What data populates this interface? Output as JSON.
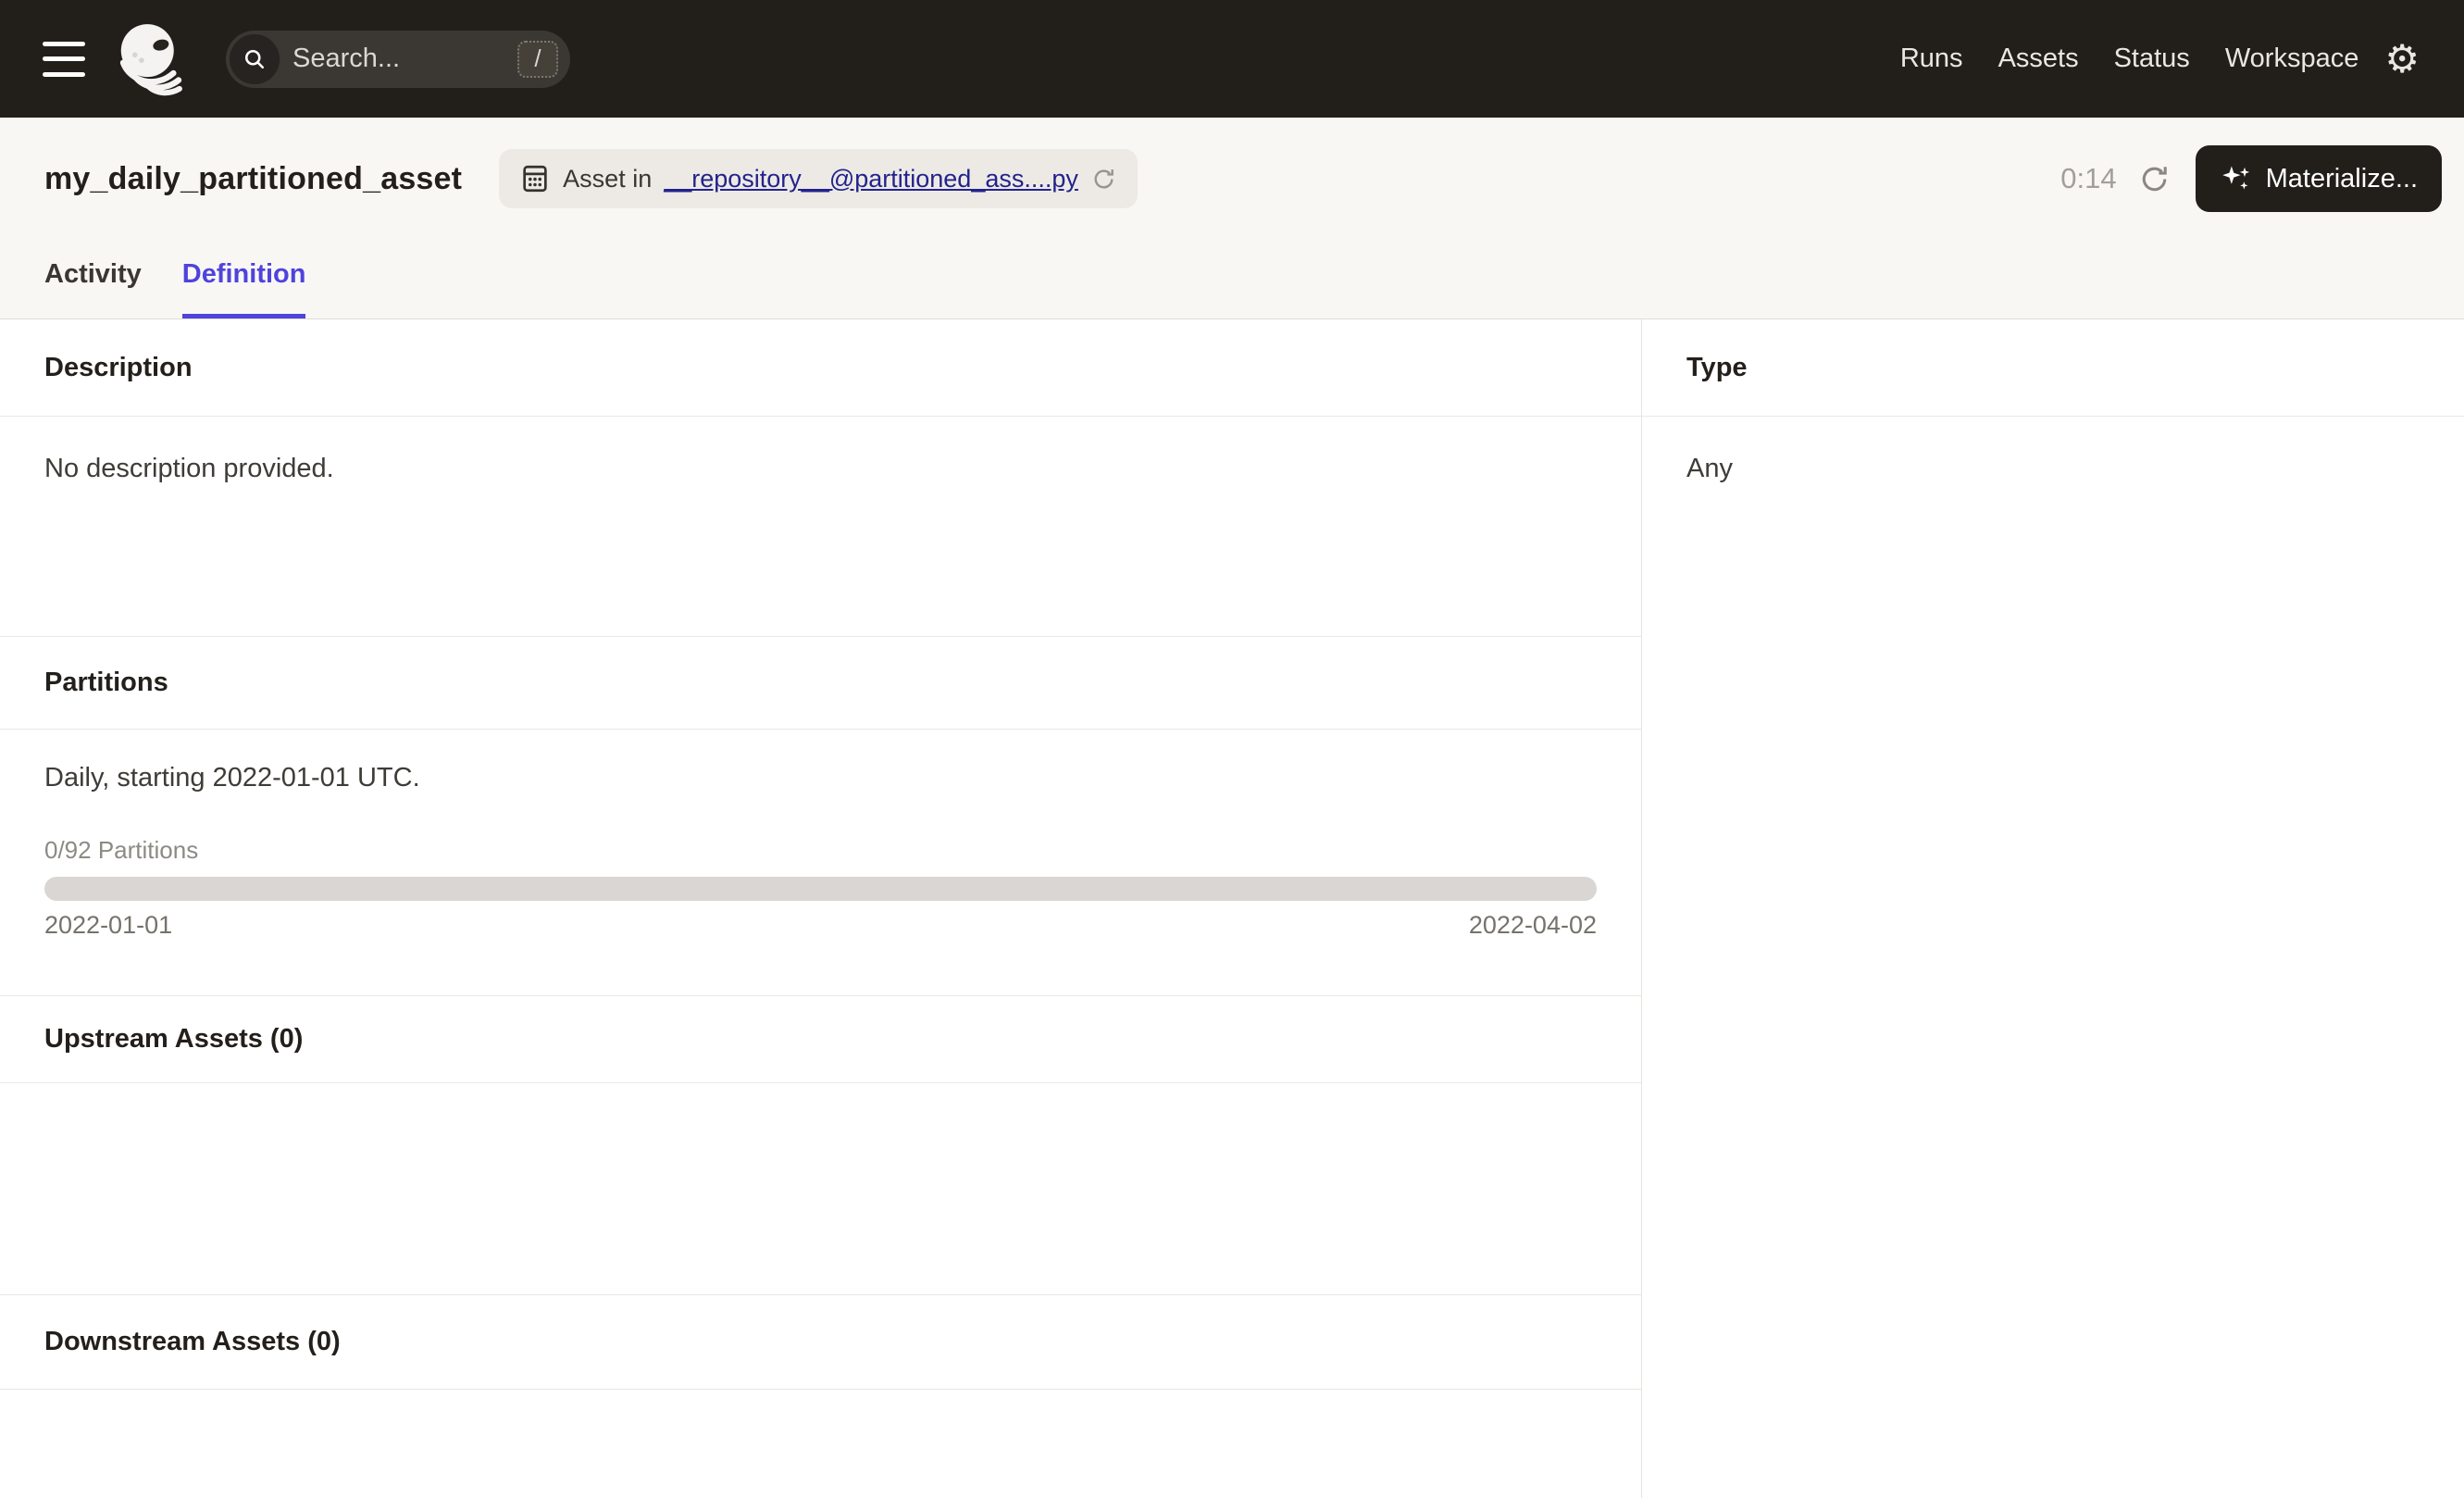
{
  "topbar": {
    "search": {
      "placeholder": "Search...",
      "shortcut": "/"
    },
    "nav": [
      {
        "label": "Runs"
      },
      {
        "label": "Assets"
      },
      {
        "label": "Status"
      },
      {
        "label": "Workspace"
      }
    ],
    "gear_glyph": "⚙"
  },
  "header": {
    "title": "my_daily_partitioned_asset",
    "badge": {
      "prefix": "Asset in",
      "link": "__repository__@partitioned_ass....py"
    },
    "timer": "0:14",
    "materialize_label": "Materialize..."
  },
  "tabs": [
    {
      "label": "Activity",
      "active": false
    },
    {
      "label": "Definition",
      "active": true
    }
  ],
  "sections": {
    "description": {
      "title": "Description",
      "body": "No description provided."
    },
    "partitions": {
      "title": "Partitions",
      "summary": "Daily, starting 2022-01-01 UTC.",
      "progress_label": "0/92 Partitions",
      "progress_percent": 0,
      "range_start": "2022-01-01",
      "range_end": "2022-04-02"
    },
    "upstream": {
      "title": "Upstream Assets (0)"
    },
    "downstream": {
      "title": "Downstream Assets (0)"
    },
    "type": {
      "title": "Type",
      "value": "Any"
    }
  },
  "colors": {
    "accent": "#4f43dd",
    "link": "#23238c",
    "topbar_bg": "#221f1b",
    "header_bg": "#f9f7f4",
    "divider": "#ebe8e3",
    "progress_track": "#d9d6d3"
  }
}
